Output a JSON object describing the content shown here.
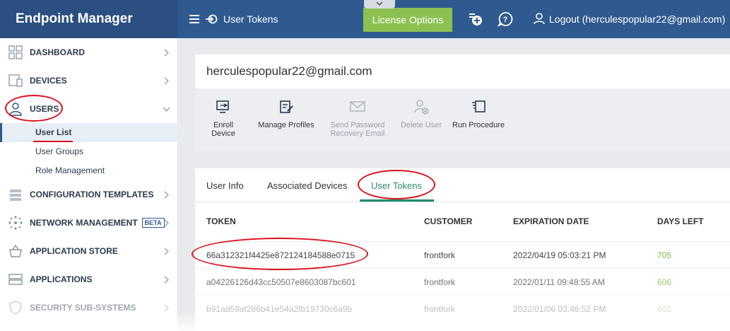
{
  "app": {
    "title": "Endpoint Manager"
  },
  "header": {
    "breadcrumb": "User Tokens",
    "license_button": "License Options",
    "logout": "Logout (herculespopular22@gmail.com)"
  },
  "sidebar": {
    "items": [
      {
        "label": "DASHBOARD"
      },
      {
        "label": "DEVICES"
      },
      {
        "label": "USERS"
      },
      {
        "label": "CONFIGURATION TEMPLATES"
      },
      {
        "label": "NETWORK MANAGEMENT",
        "badge": "BETA"
      },
      {
        "label": "APPLICATION STORE"
      },
      {
        "label": "APPLICATIONS"
      },
      {
        "label": "SECURITY SUB-SYSTEMS"
      }
    ],
    "users_sub": [
      "User List",
      "User Groups",
      "Role Management"
    ]
  },
  "user": {
    "email": "herculespopular22@gmail.com"
  },
  "toolbar": {
    "enroll": "Enroll Device",
    "manage": "Manage Profiles",
    "send1": "Send Password",
    "send2": "Recovery Email",
    "delete": "Delete User",
    "run": "Run Procedure"
  },
  "tabs": [
    "User Info",
    "Associated Devices",
    "User Tokens"
  ],
  "table": {
    "headers": [
      "TOKEN",
      "CUSTOMER",
      "EXPIRATION DATE",
      "DAYS LEFT"
    ],
    "rows": [
      [
        "66a312321f4425e872124184588e0715",
        "frontfork",
        "2022/04/19 05:03:21 PM",
        "705"
      ],
      [
        "a04226126d43cc50507e8603087bc601",
        "frontfork",
        "2022/01/11 09:48:55 AM",
        "606"
      ],
      [
        "b91ad59af286b41e54a2fb19730c6a9b",
        "frontfork",
        "2022/01/06 03:46:52 PM",
        "602"
      ]
    ]
  },
  "colors": {
    "topbar": "#2f5a8f",
    "brand": "#2a4f80",
    "license": "#8cc152",
    "active_tab": "#1f8a6e",
    "days": "#7cb342",
    "annotation": "#d9121b"
  }
}
